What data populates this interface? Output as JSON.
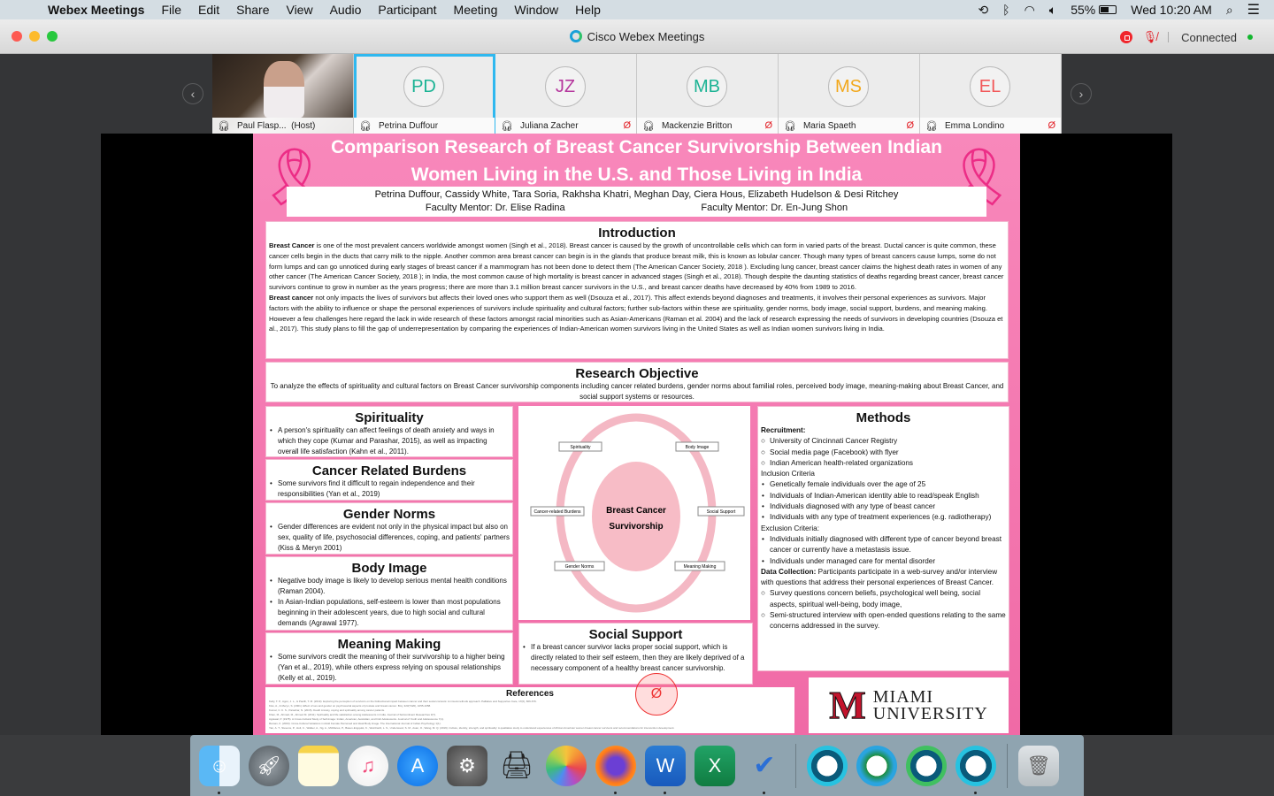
{
  "menubar": {
    "app_name": "Webex Meetings",
    "items": [
      "File",
      "Edit",
      "Share",
      "View",
      "Audio",
      "Participant",
      "Meeting",
      "Window",
      "Help"
    ],
    "battery": "55%",
    "clock": "Wed 10:20 AM",
    "icons": [
      "time-machine-icon",
      "bluetooth-icon",
      "wifi-icon",
      "volume-icon",
      "battery-icon",
      "spotlight-icon",
      "notification-center-icon"
    ]
  },
  "window": {
    "title": "Cisco Webex Meetings",
    "status": "Connected",
    "colors": {
      "recording": "#f0252b",
      "connected": "#13b62f",
      "muted": "#e21f26",
      "active_speaker": "#2fb8ef"
    }
  },
  "participants": [
    {
      "name": "Paul Flasp...",
      "role": "(Host)",
      "initials": "",
      "video": true,
      "muted": false
    },
    {
      "name": "Petrina Duffour",
      "initials": "PD",
      "color": "#1bb394",
      "active": true,
      "muted": false
    },
    {
      "name": "Juliana Zacher",
      "initials": "JZ",
      "color": "#b5369d",
      "muted": true
    },
    {
      "name": "Mackenzie Britton",
      "initials": "MB",
      "color": "#1bb394",
      "muted": true
    },
    {
      "name": "Maria Spaeth",
      "initials": "MS",
      "color": "#f2a81d",
      "muted": true
    },
    {
      "name": "Emma Londino",
      "initials": "EL",
      "color": "#f2585a",
      "muted": true
    }
  ],
  "poster": {
    "title_line1": "Comparison Research of Breast Cancer Survivorship Between Indian",
    "title_line2": "Women Living in the U.S. and Those Living in India",
    "authors": "Petrina Duffour, Cassidy White, Tara Soria, Rakhsha Khatri, Meghan Day, Ciera Hous, Elizabeth Hudelson & Desi Ritchey",
    "mentor1": "Faculty Mentor: Dr. Elise Radina",
    "mentor2": "Faculty Mentor: Dr. En-Jung Shon",
    "intro": {
      "heading": "Introduction",
      "p1_bold": "Breast Cancer",
      "p1": " is one of the most prevalent cancers worldwide amongst women (Singh et al., 2018). Breast cancer is caused by the growth of uncontrollable cells which can form in varied parts of the breast. Ductal cancer is quite common, these cancer cells begin in the ducts that carry milk to the nipple. Another common area breast cancer can begin is in the glands that produce breast milk, this is known as lobular cancer. Though many types of breast cancers cause lumps, some do not form lumps and can go unnoticed during early stages of breast cancer if a mammogram has not been done to detect them (The American Cancer Society, 2018 ). Excluding lung cancer, breast cancer claims the highest death rates in women of any other cancer (The American Cancer Society, 2018 ); in India, the most common cause of high mortality is breast cancer in advanced stages (Singh et al., 2018). Though despite the daunting statistics of deaths regarding breast cancer, breast cancer survivors continue to grow in number as the years progress; there are more than 3.1 million breast cancer survivors in the U.S., and breast cancer deaths have decreased by 40% from 1989 to 2016.",
      "p2_bold": "Breast cancer",
      "p2": " not only impacts the lives of survivors but affects their loved ones who support them as well (Dsouza et al., 2017). This affect extends beyond diagnoses and treatments, it involves their personal experiences as survivors. Major factors with the ability to influence or shape the personal experiences of survivors include spirituality and cultural factors; further sub-factors within these are spirituality, gender norms, body image, social support, burdens, and meaning making. However a few challenges here regard the lack in wide research of these factors amongst racial minorities such as Asian-Americans (Raman et al. 2004) and the lack of research expressing the needs of survivors in developing countries (Dsouza et al., 2017). This study plans to fill the gap of underrepresentation by comparing the experiences of Indian-American women survivors living in the United States as well as Indian women survivors living in India."
    },
    "objective": {
      "heading": "Research Objective",
      "text": "To analyze the effects of spirituality and cultural factors on Breast Cancer survivorship components including cancer related burdens, gender norms about familial roles, perceived body image, meaning-making about Breast Cancer, and social support systems or resources."
    },
    "spirituality": {
      "heading": "Spirituality",
      "bullets": [
        "A person's spirituality can affect feelings of death anxiety and ways in which they cope (Kumar and Parashar, 2015), as well as impacting overall life satisfaction (Kahn et al., 2011)."
      ]
    },
    "burdens": {
      "heading": "Cancer Related Burdens",
      "bullets": [
        "Some survivors find it difficult to regain independence and their responsibilities (Yan et al., 2019)"
      ]
    },
    "gender": {
      "heading": "Gender Norms",
      "bullets": [
        "Gender differences are evident not only in the physical impact but also on sex, quality of life, psychosocial differences, coping, and patients' partners (Kiss & Meryn 2001)"
      ]
    },
    "body": {
      "heading": "Body Image",
      "bullets": [
        "Negative body image is likely to develop serious mental health conditions (Raman 2004).",
        "In Asian-Indian populations, self-esteem is lower than most populations beginning in their adolescent years, due to high social and cultural demands (Agrawal 1977)."
      ]
    },
    "meaning": {
      "heading": "Meaning Making",
      "bullets": [
        "Some survivors credit the meaning of their survivorship to a higher being (Yan et al., 2019), while others express relying on spousal relationships (Kelly et al., 2019)."
      ]
    },
    "diagram": {
      "center_line1": "Breast Cancer",
      "center_line2": "Survivorship",
      "labels": [
        "Spirituality",
        "Body Image",
        "Cancer-related Burdens",
        "Social Support",
        "Gender Norms",
        "Meaning Making"
      ]
    },
    "social": {
      "heading": "Social Support",
      "bullets": [
        "If a breast cancer survivor lacks proper social support, which is directly related to their self esteem, then they are likely deprived of a necessary component of a healthy breast cancer survivorship."
      ]
    },
    "methods": {
      "heading": "Methods",
      "recruitment_label": "Recruitment:",
      "recruitment": [
        "University of Cincinnati Cancer Registry",
        "Social media page (Facebook) with flyer",
        "Indian American health-related organizations"
      ],
      "inclusion_label": "Inclusion Criteria",
      "inclusion": [
        "Genetically female individuals over the age of 25",
        "Individuals of Indian-American identity able to read/speak English",
        "Individuals diagnosed with any type of beast cancer",
        "Individuals with any type of treatment experiences (e.g. radiotherapy)"
      ],
      "exclusion_label": "Exclusion Criteria:",
      "exclusion": [
        "Individuals initially diagnosed with different type of cancer beyond breast cancer or currently have a metastasis issue.",
        "Individuals under managed care for mental disorder"
      ],
      "data_label": "Data Collection:",
      "data_text": " Participants participate in a web-survey and/or interview with questions that address their personal experiences of Breast Cancer.",
      "data_items": [
        "Survey questions concern beliefs, psychological well being, social aspects, spiritual well-being, body image,",
        "Semi-structured interview with open-ended questions relating to the same concerns addressed in the survey."
      ]
    },
    "references": {
      "heading": "References",
      "items": [
        "Kelly, T. P., Agon, J. L., & Paoilli, T. M. (2019). Exploring the perception of survivors on the bidirectional impact between cancer and their social contexts: A mixed-methods approach. Palliative and Supportive Care, 17(6), 666-676.",
        "Kiss, A., & Meryn, S. (2001). Effect of sex and gender on psychosocial aspects of prostate and breast cancer. Bmj, 323(7320), 1055-1058.",
        "Kumar, C. K. S., Parashar, N. (2015). Death Anxiety, coping and spirituality among cancer patients.",
        "Khan, M., Ahmad, M., Ahmed M. (2011). Spirituality and life satisfaction among Adolescents in India. Journal of Subcontinent Researches 3(7).",
        "Agrawal, P. (1978). A Cross-Cultural Study of Self-Image: Indian, American, Australian, and Irish Adolescents. Journal of Youth and Adolescence 7(1).",
        "Raman, K. (2003). Cross-Cultural Variations in Adult Female Perceived and Ideal Body Image. The International Journal of Indian Psychology 1(1).",
        "Yan, A. T., Stevens, P., Holt, C., Walker, A., Ng, A., McManus, P., Basen-Engquist, K., Weinhardt, L. S., Underwood, S. M., Asan, O., Wang, M. Q. (2019). Culture, identity, strength, and spirituality: A qualitative study to understand experiences of African American women breast cancer survivors and recommendations for intervention development."
      ]
    },
    "logo": {
      "letter": "M",
      "line1": "MIAMI",
      "line2": "UNIVERSITY"
    }
  },
  "dock": [
    {
      "name": "finder",
      "running": true
    },
    {
      "name": "launchpad",
      "running": false
    },
    {
      "name": "notes",
      "running": false
    },
    {
      "name": "music",
      "running": false
    },
    {
      "name": "app-store",
      "running": false
    },
    {
      "name": "system-preferences",
      "running": false
    },
    {
      "name": "printer",
      "running": false
    },
    {
      "name": "photos",
      "running": false
    },
    {
      "name": "firefox",
      "running": true
    },
    {
      "name": "word",
      "running": true
    },
    {
      "name": "excel",
      "running": false
    },
    {
      "name": "todo",
      "running": true
    },
    {
      "name": "webex-1",
      "running": false
    },
    {
      "name": "webex-2",
      "running": false
    },
    {
      "name": "webex-3",
      "running": false
    },
    {
      "name": "webex-meetings",
      "running": true
    },
    {
      "name": "trash",
      "running": false
    }
  ]
}
